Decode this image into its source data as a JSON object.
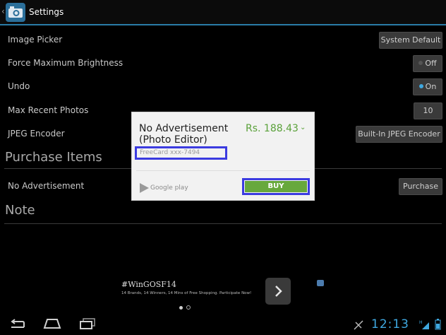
{
  "header": {
    "title": "Settings"
  },
  "settings": [
    {
      "label": "Image Picker",
      "value": "System Default"
    },
    {
      "label": "Force Maximum Brightness",
      "value": "Off"
    },
    {
      "label": "Undo",
      "value": "On"
    },
    {
      "label": "Max Recent Photos",
      "value": "10"
    },
    {
      "label": "JPEG Encoder",
      "value": "Built-In JPEG Encoder"
    }
  ],
  "purchase": {
    "section_title": "Purchase Items",
    "item_label": "No Advertisement",
    "button_label": "Purchase"
  },
  "note": {
    "section_title": "Note"
  },
  "dialog": {
    "item_title": "No Advertisement (Photo Editor)",
    "price": "Rs. 188.43",
    "payment": "FreeCard xxx-7494",
    "store_label": "Google play",
    "buy_label": "BUY"
  },
  "ad": {
    "hashtag": "#WinGOSF14",
    "subtext": "14 Brands, 14 Winners, 14 Mins of Free Shopping. Participate Now!"
  },
  "status": {
    "time": "12:13"
  },
  "colors": {
    "accent": "#3fa8e0",
    "buy": "#67a83c",
    "highlight": "#3b3be0",
    "price": "#5aa13a"
  }
}
